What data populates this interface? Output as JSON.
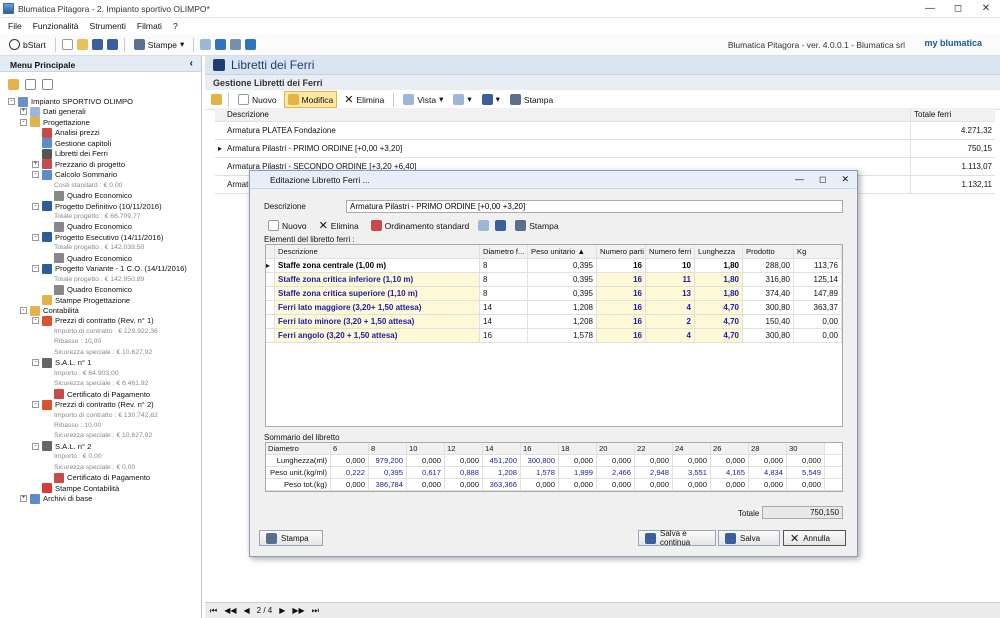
{
  "window": {
    "title": "Blumatica Pitagora - 2. Impianto sportivo OLIMPO*"
  },
  "menu": [
    "File",
    "Funzionalità",
    "Strumenti",
    "Filmati",
    "?"
  ],
  "toolbar": {
    "start": "bStart",
    "stampe": "Stampe"
  },
  "brand": {
    "version": "Blumatica Pitagora - ver. 4.0.0.1 - Blumatica srl",
    "logo": "my blumatica"
  },
  "sidebar": {
    "title": "Menu Principale",
    "tree": [
      {
        "label": "Impianto SPORTIVO OLIMPO",
        "level": 0,
        "kind": "node",
        "exp": "-",
        "color": "#6a8fc8"
      },
      {
        "label": "Dati generali",
        "level": 1,
        "kind": "node",
        "exp": "+",
        "color": "#9db7d9"
      },
      {
        "label": "Progettazione",
        "level": 1,
        "kind": "node",
        "exp": "-",
        "color": "#e3b348"
      },
      {
        "label": "Analisi prezzi",
        "level": 2,
        "kind": "node",
        "color": "#c94a4a"
      },
      {
        "label": "Gestione capitoli",
        "level": 2,
        "kind": "node",
        "color": "#5b8ccc"
      },
      {
        "label": "Libretti dei Ferri",
        "level": 2,
        "kind": "node",
        "color": "#555"
      },
      {
        "label": "Prezzario di progetto",
        "level": 2,
        "kind": "node",
        "exp": "+",
        "color": "#c94a4a"
      },
      {
        "label": "Calcolo Sommario",
        "level": 2,
        "kind": "node",
        "exp": "-",
        "color": "#5b8ccc"
      },
      {
        "label": "Costi standard : € 0,00",
        "level": 3,
        "kind": "sub"
      },
      {
        "label": "Quadro Economico",
        "level": 3,
        "kind": "node",
        "color": "#888"
      },
      {
        "label": "Progetto Definitivo (10/11/2016)",
        "level": 2,
        "kind": "node",
        "exp": "-",
        "color": "#2b5c9c"
      },
      {
        "label": "Totale progetto : € 66.709,77",
        "level": 3,
        "kind": "sub"
      },
      {
        "label": "Quadro Economico",
        "level": 3,
        "kind": "node",
        "color": "#888"
      },
      {
        "label": "Progetto Esecutivo (14/11/2016)",
        "level": 2,
        "kind": "node",
        "exp": "-",
        "color": "#2b5c9c"
      },
      {
        "label": "Totale progetto : € 142.039,50",
        "level": 3,
        "kind": "sub"
      },
      {
        "label": "Quadro Economico",
        "level": 3,
        "kind": "node",
        "color": "#888"
      },
      {
        "label": "Progetto Variante - 1 C.O. (14/11/2016)",
        "level": 2,
        "kind": "node",
        "exp": "-",
        "color": "#2b5c9c"
      },
      {
        "label": "Totale progetto : € 142.950,89",
        "level": 3,
        "kind": "sub"
      },
      {
        "label": "Quadro Economico",
        "level": 3,
        "kind": "node",
        "color": "#888"
      },
      {
        "label": "Stampe Progettazione",
        "level": 2,
        "kind": "node",
        "color": "#e3b348"
      },
      {
        "label": "Contabilità",
        "level": 1,
        "kind": "node",
        "exp": "-",
        "color": "#e3b348"
      },
      {
        "label": "Prezzi di contratto (Rev. n° 1)",
        "level": 2,
        "kind": "node",
        "exp": "-",
        "color": "#d9532c"
      },
      {
        "label": "Importo di contratto : € 129.922,36",
        "level": 3,
        "kind": "sub"
      },
      {
        "label": "Ribasso : 10,00",
        "level": 3,
        "kind": "sub"
      },
      {
        "label": "Sicurezza speciale : € 10.627,92",
        "level": 3,
        "kind": "sub"
      },
      {
        "label": "S.A.L. n° 1",
        "level": 2,
        "kind": "node",
        "exp": "-",
        "color": "#666"
      },
      {
        "label": "Importo : € 64.903,00",
        "level": 3,
        "kind": "sub"
      },
      {
        "label": "Sicurezza speciale : € 6.461,92",
        "level": 3,
        "kind": "sub"
      },
      {
        "label": "Certificato di Pagamento",
        "level": 3,
        "kind": "node",
        "color": "#c94a4a"
      },
      {
        "label": "Prezzi di contratto (Rev. n° 2)",
        "level": 2,
        "kind": "node",
        "exp": "-",
        "color": "#d9532c"
      },
      {
        "label": "Importo di contratto : € 130.742,62",
        "level": 3,
        "kind": "sub"
      },
      {
        "label": "Ribasso : 10,00",
        "level": 3,
        "kind": "sub"
      },
      {
        "label": "Sicurezza speciale : € 10.627,92",
        "level": 3,
        "kind": "sub"
      },
      {
        "label": "S.A.L. n° 2",
        "level": 2,
        "kind": "node",
        "exp": "-",
        "color": "#666"
      },
      {
        "label": "Importo : € 0,00",
        "level": 3,
        "kind": "sub"
      },
      {
        "label": "Sicurezza speciale : € 0,00",
        "level": 3,
        "kind": "sub"
      },
      {
        "label": "Certificato di Pagamento",
        "level": 3,
        "kind": "node",
        "color": "#c94a4a"
      },
      {
        "label": "Stampe Contabilità",
        "level": 2,
        "kind": "node",
        "color": "#d93a3a"
      },
      {
        "label": "Archivi di base",
        "level": 1,
        "kind": "node",
        "exp": "+",
        "color": "#5b8ccc"
      }
    ]
  },
  "main": {
    "title": "Libretti dei Ferri",
    "subtitle": "Gestione Libretti dei Ferri",
    "toolbar": {
      "nuovo": "Nuovo",
      "modifica": "Modifica",
      "elimina": "Elimina",
      "vista": "Vista",
      "stampa": "Stampa"
    },
    "columns": {
      "descrizione": "Descrizione",
      "totale": "Totale ferri"
    },
    "rows": [
      {
        "desc": "Armatura PLATEA Fondazione",
        "total": "4.271,32",
        "marker": ""
      },
      {
        "desc": "Armatura Pilastri - PRIMO ORDINE [+0,00 +3,20]",
        "total": "750,15",
        "marker": "▸"
      },
      {
        "desc": "Armatura Pilastri - SECONDO ORDINE [+3,20 +6,40]",
        "total": "1.113,07",
        "marker": ""
      },
      {
        "desc": "Armatura Pilastri - TERZO ORDINE",
        "total": "1.132,11",
        "marker": ""
      }
    ],
    "nav": {
      "page": "2 / 4"
    }
  },
  "dialog": {
    "title": "Editazione Libretto Ferri ...",
    "desc_label": "Descrizione",
    "desc_value": "Armatura Pilastri - PRIMO ORDINE [+0,00 +3,20]",
    "toolbar": {
      "nuovo": "Nuovo",
      "elimina": "Elimina",
      "ordinamento": "Ordinamento standard",
      "stampa": "Stampa"
    },
    "elements_label": "Elementi del libretto ferri :",
    "columns": [
      "Descrizione",
      "Diametro f...",
      "Peso unitario",
      "Numero parti",
      "Numero ferri",
      "Lunghezza",
      "Prodotto",
      "Kg"
    ],
    "elements": [
      {
        "marker": "▸",
        "desc": "Staffe zona centrale (1,00 m)",
        "diam": "8",
        "peso": "0,395",
        "parti": "16",
        "ferri": "10",
        "lung": "1,80",
        "prod": "288,00",
        "kg": "113,76",
        "style": "blk"
      },
      {
        "marker": "",
        "desc": "Staffe zona critica inferiore (1,10 m)",
        "diam": "8",
        "peso": "0,395",
        "parti": "16",
        "ferri": "11",
        "lung": "1,80",
        "prod": "316,80",
        "kg": "125,14",
        "style": "bold y"
      },
      {
        "marker": "",
        "desc": "Staffe zona critica superiore (1,10 m)",
        "diam": "8",
        "peso": "0,395",
        "parti": "16",
        "ferri": "13",
        "lung": "1,80",
        "prod": "374,40",
        "kg": "147,89",
        "style": "bold y"
      },
      {
        "marker": "",
        "desc": "Ferri lato maggiore (3,20+ 1,50 attesa)",
        "diam": "14",
        "peso": "1,208",
        "parti": "16",
        "ferri": "4",
        "lung": "4,70",
        "prod": "300,80",
        "kg": "363,37",
        "style": "bold y"
      },
      {
        "marker": "",
        "desc": "Ferri lato minore (3,20 + 1,50 attesa)",
        "diam": "14",
        "peso": "1,208",
        "parti": "16",
        "ferri": "2",
        "lung": "4,70",
        "prod": "150,40",
        "kg": "0,00",
        "style": "bold y"
      },
      {
        "marker": "",
        "desc": "Ferri angolo (3,20 + 1,50 attesa)",
        "diam": "16",
        "peso": "1,578",
        "parti": "16",
        "ferri": "4",
        "lung": "4,70",
        "prod": "300,80",
        "kg": "0,00",
        "style": "bold y"
      }
    ],
    "summary_label": "Sommario del libretto",
    "summary": {
      "head": [
        "Diametro",
        "6",
        "8",
        "10",
        "12",
        "14",
        "16",
        "18",
        "20",
        "22",
        "24",
        "26",
        "28",
        "30"
      ],
      "rows": [
        [
          "Lunghezza(ml)",
          "0,000",
          "979,200",
          "0,000",
          "0,000",
          "451,200",
          "300,800",
          "0,000",
          "0,000",
          "0,000",
          "0,000",
          "0,000",
          "0,000",
          "0,000"
        ],
        [
          "Peso unit.(kg/ml)",
          "0,222",
          "0,395",
          "0,617",
          "0,888",
          "1,208",
          "1,578",
          "1,999",
          "2,466",
          "2,948",
          "3,551",
          "4,165",
          "4,834",
          "5,549"
        ],
        [
          "Peso tot.(kg)",
          "0,000",
          "386,784",
          "0,000",
          "0,000",
          "363,366",
          "0,000",
          "0,000",
          "0,000",
          "0,000",
          "0,000",
          "0,000",
          "0,000",
          "0,000"
        ]
      ]
    },
    "total_label": "Totale",
    "total_value": "750,150",
    "buttons": {
      "stampa": "Stampa",
      "salva_continua": "Salva e continua",
      "salva": "Salva",
      "annulla": "Annulla"
    }
  }
}
